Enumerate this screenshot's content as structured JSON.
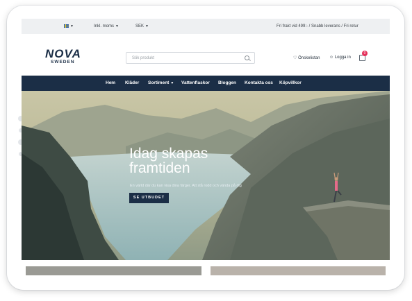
{
  "topbar": {
    "vat": "Inkl. moms",
    "currency": "SEK",
    "shipping": "Fri frakt vid 499:- / Snabb leverans / Fri retur"
  },
  "header": {
    "logo_word": "NOVA",
    "logo_sub": "SWEDEN",
    "search_placeholder": "Sök produkt",
    "wishlist": "Önskelistan",
    "login": "Logga in",
    "cart_count": "0"
  },
  "nav": {
    "items": [
      "Hem",
      "Kläder",
      "Sortiment",
      "Vattenflaskor",
      "Bloggen",
      "Kontakta oss",
      "Köpvillkor"
    ]
  },
  "hero": {
    "title_line1": "Idag skapas",
    "title_line2": "framtiden",
    "subtitle": "En värld där du kan visa dina färger. Att stå rodd och vända på dig",
    "cta": "SE UTBUDET"
  },
  "colors": {
    "navy": "#1b2e46",
    "badge": "#e4305a",
    "topbar_bg": "#eef0f2"
  }
}
